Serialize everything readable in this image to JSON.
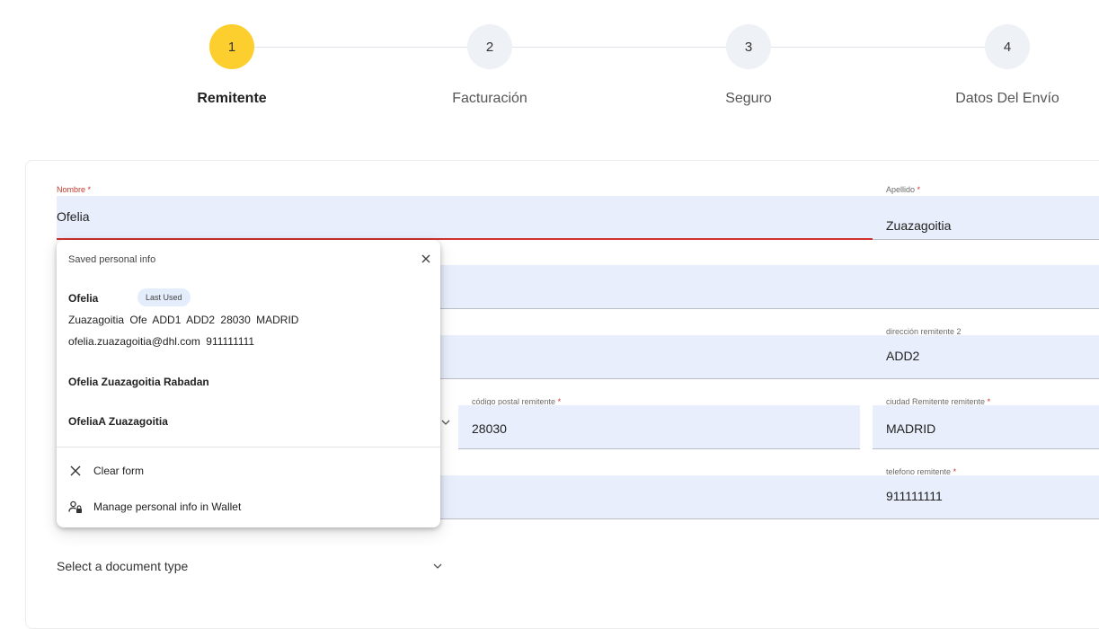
{
  "stepper": {
    "steps": [
      {
        "number": "1",
        "label": "Remitente",
        "active": true
      },
      {
        "number": "2",
        "label": "Facturación",
        "active": false
      },
      {
        "number": "3",
        "label": "Seguro",
        "active": false
      },
      {
        "number": "4",
        "label": "Datos Del Envío",
        "active": false
      }
    ]
  },
  "form": {
    "nombre": {
      "label": "Nombre",
      "required_mark": "*",
      "value": "Ofelia"
    },
    "apellido": {
      "label": "Apellido",
      "required_mark": "*",
      "value": "Zuazagoitia"
    },
    "direccion2": {
      "label": "dirección remitente 2",
      "value": "ADD2"
    },
    "codigo_postal": {
      "label": "código postal remitente",
      "required_mark": "*",
      "value": "28030"
    },
    "ciudad": {
      "label": "ciudad Remitente remitente",
      "required_mark": "*",
      "value": "MADRID"
    },
    "telefono": {
      "label": "telefono remitente",
      "required_mark": "*",
      "value": "911111111"
    },
    "document_type": {
      "placeholder": "Select a document type"
    }
  },
  "autofill": {
    "header": "Saved personal info",
    "entries": [
      {
        "name": "Ofelia",
        "badge": "Last Used",
        "address_line": "Zuazagoitia Ofe ADD1 ADD2 28030 MADRID",
        "contact_line": "ofelia.zuazagoitia@dhl.com 911111111"
      },
      {
        "name": "Ofelia Zuazagoitia Rabadan"
      },
      {
        "name": "OfeliaA Zuazagoitia"
      }
    ],
    "clear_label": "Clear form",
    "manage_label": "Manage personal info in Wallet"
  },
  "colors": {
    "active_step": "#fccf2e",
    "field_bg": "#e8eefb",
    "error": "#d0312d"
  }
}
